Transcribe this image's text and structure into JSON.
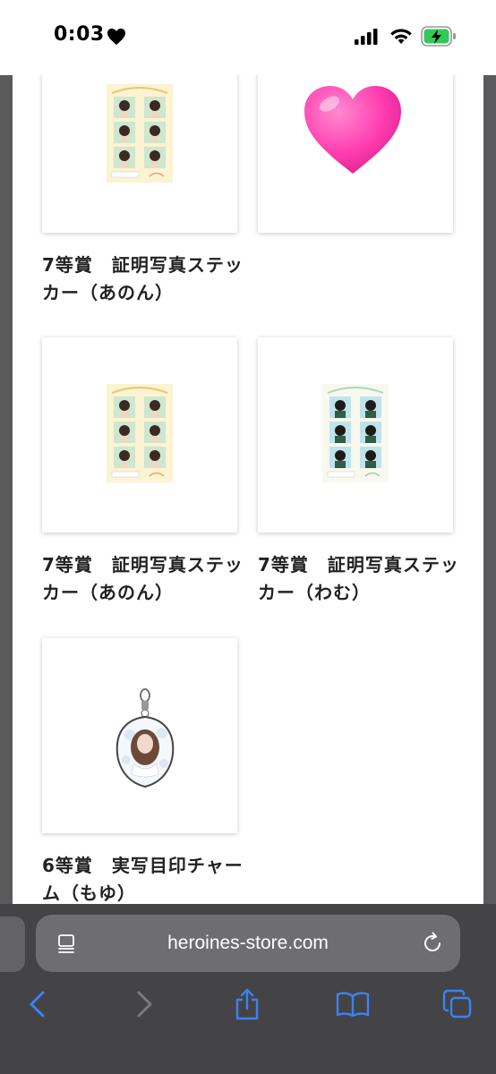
{
  "status_bar": {
    "time": "0:03",
    "focus_icon": "heart-icon",
    "icons": [
      "signal-icon",
      "wifi-icon",
      "battery-charging-icon"
    ],
    "battery_color": "#34c759"
  },
  "products": [
    {
      "title": "7等賞　証明写真ステッカー（あのん）",
      "image": "photo-sticker-sheet"
    },
    {
      "title": "",
      "image": "pink-heart-emoji"
    },
    {
      "title": "7等賞　証明写真ステッカー（あのん）",
      "image": "photo-sticker-sheet"
    },
    {
      "title": "7等賞　証明写真ステッカー（わむ）",
      "image": "photo-sticker-sheet"
    },
    {
      "title": "6等賞　実写目印チャーム（もゆ）",
      "image": "acrylic-charm"
    }
  ],
  "browser": {
    "url": "heroines-store.com",
    "toolbar": [
      "back",
      "forward",
      "share",
      "bookmarks",
      "tabs"
    ],
    "accent_color": "#3b82f6"
  }
}
